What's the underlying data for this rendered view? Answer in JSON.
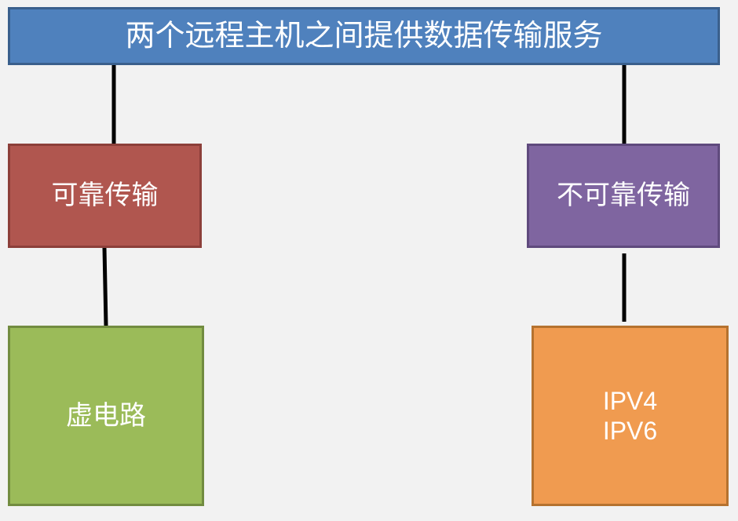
{
  "diagram": {
    "root": {
      "label": "两个远程主机之间提供数据传输服务"
    },
    "reliable": {
      "label": "可靠传输"
    },
    "unreliable": {
      "label": "不可靠传输"
    },
    "virtual_circuit": {
      "label": "虚电路"
    },
    "ip_versions": {
      "items": [
        "IPV4",
        "IPV6"
      ]
    }
  },
  "colors": {
    "background": "#f2f2f2",
    "root_fill": "#4f81bd",
    "reliable_fill": "#b0564f",
    "unreliable_fill": "#7f65a0",
    "virtual_circuit_fill": "#9bbb59",
    "ip_fill": "#f09b50",
    "connector": "#000000"
  }
}
